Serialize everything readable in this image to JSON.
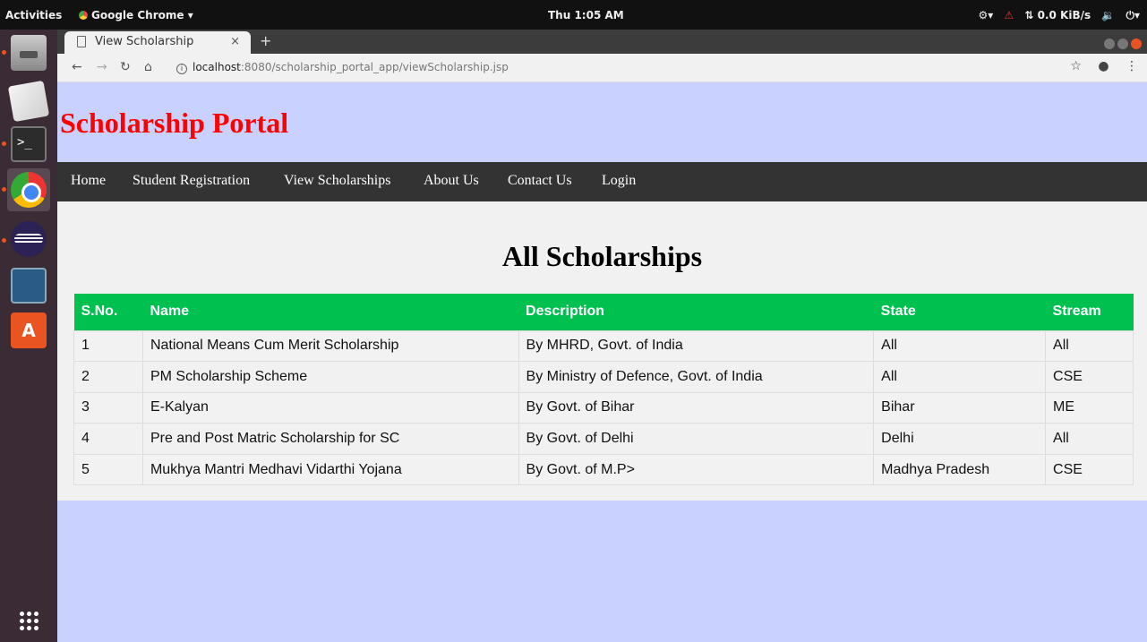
{
  "topbar": {
    "activities": "Activities",
    "app_menu": "Google Chrome ▾",
    "clock": "Thu  1:05 AM",
    "network": "⇅ 0.0 KiB/s",
    "tray_icons": [
      "accessibility-icon",
      "warning-icon",
      "network-speed",
      "volume-icon",
      "power-icon"
    ]
  },
  "browser": {
    "tab_title": "View Scholarship",
    "tab_close": "×",
    "new_tab": "+",
    "url_host": "localhost",
    "url_rest": ":8080/scholarship_portal_app/viewScholarship.jsp"
  },
  "site": {
    "title": "Scholarship Portal",
    "nav": [
      "Home",
      "Student Registration",
      "View Scholarships",
      "About Us",
      "Contact Us",
      "Login"
    ]
  },
  "main": {
    "heading": "All Scholarships",
    "table": {
      "headers": [
        "S.No.",
        "Name",
        "Description",
        "State",
        "Stream"
      ],
      "rows": [
        [
          "1",
          "National Means Cum Merit Scholarship",
          "By MHRD, Govt. of India",
          "All",
          "All"
        ],
        [
          "2",
          "PM Scholarship Scheme",
          "By Ministry of Defence, Govt. of India",
          "All",
          "CSE"
        ],
        [
          "3",
          "E-Kalyan",
          "By Govt. of Bihar",
          "Bihar",
          "ME"
        ],
        [
          "4",
          "Pre and Post Matric Scholarship for SC",
          "By Govt. of Delhi",
          "Delhi",
          "All"
        ],
        [
          "5",
          "Mukhya Mantri Medhavi Vidarthi Yojana",
          "By Govt. of M.P>",
          "Madhya Pradesh",
          "CSE"
        ]
      ]
    }
  },
  "colors": {
    "header_bg": "#c8d1ff",
    "title_red": "#ff0000",
    "nav_bg": "#333333",
    "table_header_green": "#00c050"
  }
}
